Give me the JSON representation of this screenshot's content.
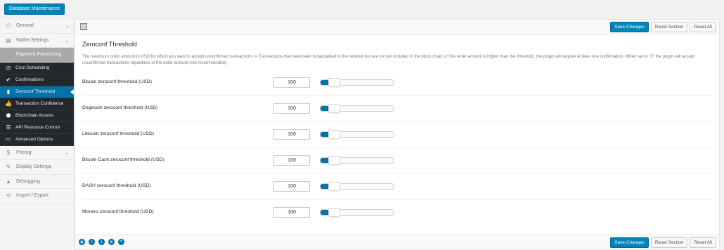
{
  "topbar": {
    "db_button": "Database Maintenance"
  },
  "sidebar": {
    "items_top": [
      {
        "label": "General",
        "icon": "power-icon",
        "glyph": "⏻",
        "chevron": true
      },
      {
        "label": "Wallet Settings",
        "icon": "wallet-icon",
        "glyph": "▤",
        "chevron": true
      },
      {
        "label": "Payment Processing",
        "icon": "cart-icon",
        "glyph": "🛒",
        "chevron": false
      }
    ],
    "subitems": [
      {
        "label": "Cron Scheduling",
        "icon": "clock-icon",
        "glyph": "◷"
      },
      {
        "label": "Confirmations",
        "icon": "check-icon",
        "glyph": "✔"
      },
      {
        "label": "Zeroconf Threshold",
        "icon": "signal-icon",
        "glyph": "▮"
      },
      {
        "label": "Transaction Confidence",
        "icon": "thumbs-up-icon",
        "glyph": "👍"
      },
      {
        "label": "Blockchain Access",
        "icon": "cubes-icon",
        "glyph": "⬢"
      },
      {
        "label": "API Resource Control",
        "icon": "database-icon",
        "glyph": "☰"
      },
      {
        "label": "Advanced Options",
        "icon": "list-icon",
        "glyph": "≔"
      }
    ],
    "items_bottom": [
      {
        "label": "Pricing",
        "icon": "dollar-icon",
        "glyph": "$",
        "chevron": true
      },
      {
        "label": "Display Settings",
        "icon": "brush-icon",
        "glyph": "✎",
        "chevron": false
      },
      {
        "label": "Debugging",
        "icon": "warning-icon",
        "glyph": "▲",
        "chevron": false
      },
      {
        "label": "Import / Export",
        "icon": "refresh-icon",
        "glyph": "⟲",
        "chevron": false
      }
    ]
  },
  "toolbar": {
    "save": "Save Changes",
    "reset_section": "Reset Section",
    "reset_all": "Reset All"
  },
  "section": {
    "title": "Zeroconf Threshold",
    "description": "The maximum order amount in USD for which you want to accept unconfirmed transactions (= Transactions that have been broadcasted to the network but are not yet included in the block chain.) If the order amount is higher than the threshold, the plugin will require at least one confirmation. When set to \"0\" the plugin will accept unconfirmed transactions regardless of the order amount (not recommended)."
  },
  "fields": [
    {
      "label": "Bitcoin zeroconf threshold (USD)",
      "value": "100",
      "slider_fraction": 0.1
    },
    {
      "label": "Dogecoin zeroconf threshold (USD)",
      "value": "100",
      "slider_fraction": 0.1
    },
    {
      "label": "Litecoin zeroconf threshold (USD)",
      "value": "100",
      "slider_fraction": 0.1
    },
    {
      "label": "Bitcoin Cash zeroconf threshold (USD)",
      "value": "100",
      "slider_fraction": 0.1
    },
    {
      "label": "DASH zeroconf threshold (USD)",
      "value": "100",
      "slider_fraction": 0.1
    },
    {
      "label": "Monero zeroconf threshold (USD)",
      "value": "100",
      "slider_fraction": 0.1
    }
  ],
  "social_icons": [
    {
      "icon": "github-icon",
      "glyph": "◉"
    },
    {
      "icon": "facebook-icon",
      "glyph": "f"
    },
    {
      "icon": "twitter-icon",
      "glyph": "t"
    },
    {
      "icon": "globe-icon",
      "glyph": "⊕"
    },
    {
      "icon": "help-icon",
      "glyph": "?"
    }
  ],
  "colors": {
    "accent": "#0073aa",
    "button": "#0085ba",
    "sidebar_dark": "#23282d"
  }
}
